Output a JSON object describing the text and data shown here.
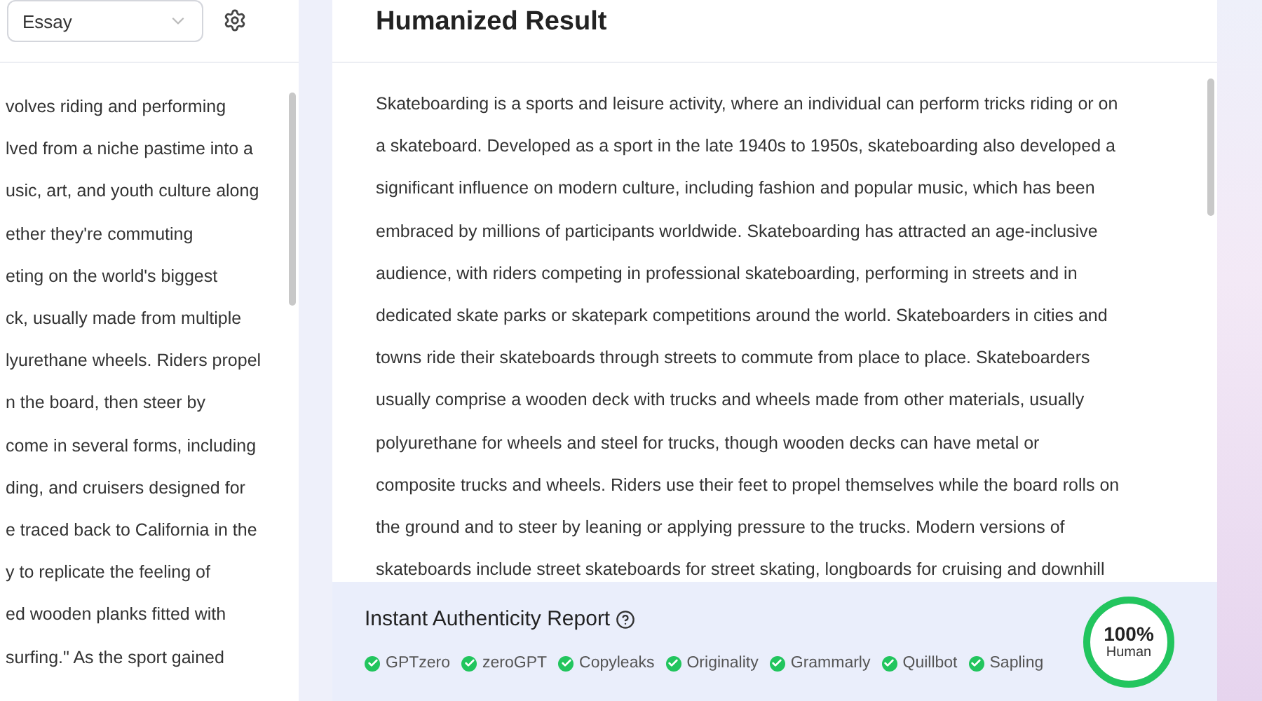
{
  "input_panel": {
    "mode_select": {
      "value": "Essay"
    },
    "text_lines": [
      "volves riding and performing",
      "lved from a niche pastime into a",
      "usic, art, and youth culture along",
      "ether they're commuting",
      "eting on the world's biggest",
      "ck, usually made from multiple",
      "lyurethane wheels. Riders propel",
      "n the board, then steer by",
      "come in several forms, including",
      "ding, and cruisers designed for",
      "e traced back to California in the",
      "y to replicate the feeling of",
      "ed wooden planks fitted with",
      "surfing.\" As the sport gained"
    ]
  },
  "result_panel": {
    "title": "Humanized Result",
    "text_lines": [
      "Skateboarding is a sports and leisure activity, where an individual can perform tricks riding or on",
      "a skateboard. Developed as a sport in the late 1940s to 1950s, skateboarding also developed a",
      "significant influence on modern culture, including fashion and popular music, which has been",
      "embraced by millions of participants worldwide. Skateboarding has attracted an age-inclusive",
      "audience, with riders competing in professional skateboarding, performing in streets and in",
      "dedicated skate parks or skatepark competitions around the world. Skateboarders in cities and",
      "towns ride their skateboards through streets to commute from place to place. Skateboarders",
      "usually comprise a wooden deck with trucks and wheels made from other materials, usually",
      "polyurethane for wheels and steel for trucks, though wooden decks can have metal or",
      "composite trucks and wheels. Riders use their feet to propel themselves while the board rolls on",
      "the ground and to steer by leaning or applying pressure to the trucks. Modern versions of",
      "skateboards include street skateboards for street skating, longboards for cruising and downhill"
    ]
  },
  "report": {
    "title": "Instant Authenticity Report",
    "detectors": [
      {
        "name": "GPTzero",
        "passed": true
      },
      {
        "name": "zeroGPT",
        "passed": true
      },
      {
        "name": "Copyleaks",
        "passed": true
      },
      {
        "name": "Originality",
        "passed": true
      },
      {
        "name": "Grammarly",
        "passed": true
      },
      {
        "name": "Quillbot",
        "passed": true
      },
      {
        "name": "Sapling",
        "passed": true
      }
    ],
    "score": {
      "value": "100%",
      "label": "Human",
      "level": 1
    }
  }
}
